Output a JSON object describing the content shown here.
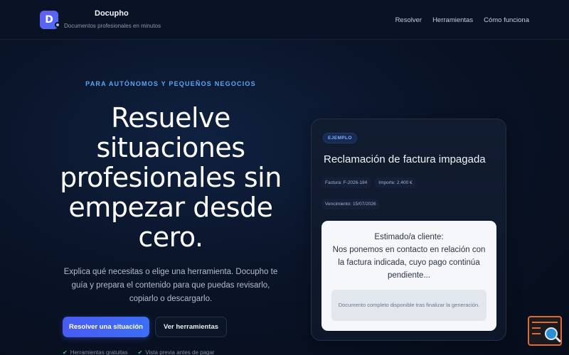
{
  "header": {
    "logo_letter": "D",
    "brand_name": "Docupho",
    "brand_tagline": "Documentos profesionales en minutos",
    "nav": [
      "Resolver",
      "Herramientas",
      "Cómo funciona"
    ]
  },
  "hero": {
    "eyebrow": "PARA AUTÓNOMOS Y PEQUEÑOS NEGOCIOS",
    "headline": "Resuelve situaciones profesionales sin empezar desde cero.",
    "subtitle": "Explica qué necesitas o elige una herramienta. Docupho te guía y prepara el contenido para que puedas revisarlo, copiarlo o descargarlo.",
    "primary_button": "Resolver una situación",
    "secondary_button": "Ver herramientas",
    "features": [
      "Herramientas gratuitas",
      "Vista previa antes de pagar"
    ]
  },
  "example": {
    "badge": "EJEMPLO",
    "title": "Reclamación de factura impagada",
    "invoice": "Factura: F-2026-184",
    "amount": "Importe: 2.400 €",
    "due": "Vencimiento: 15/07/2026",
    "doc_text": "Estimado/a cliente:\nNos ponemos en contacto en relación con la factura indicada, cuyo pago continúa pendiente...",
    "doc_note": "Documento completo disponible tras finalizar la generación."
  },
  "colors": {
    "accent": "#4a5cf0",
    "eyebrow": "#5aa6f5",
    "widget_border": "#e06a35"
  }
}
